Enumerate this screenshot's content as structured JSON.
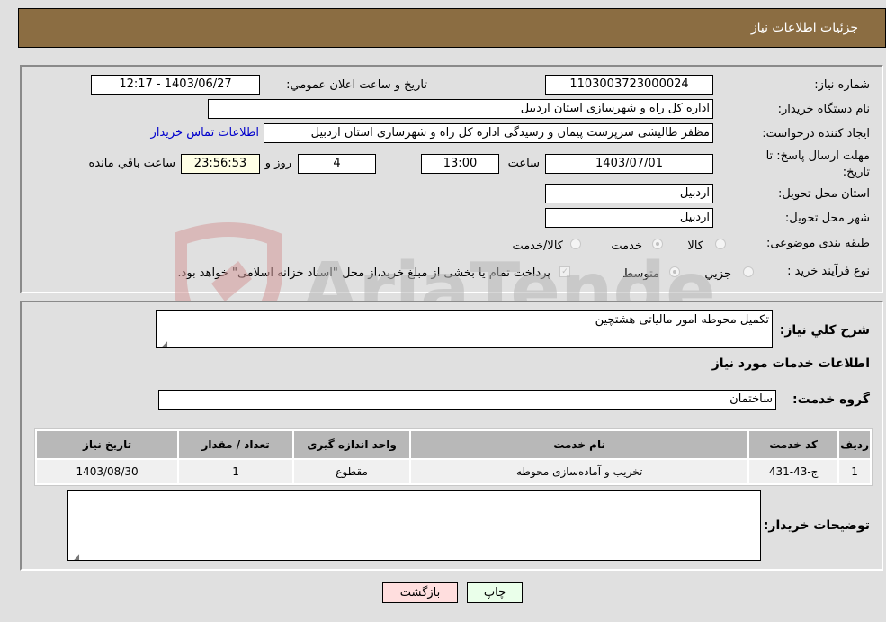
{
  "header": {
    "title": "جزئیات اطلاعات نیاز"
  },
  "need_info": {
    "need_number_label": "شماره نیاز:",
    "need_number": "1103003723000024",
    "announce_label": "تاریخ و ساعت اعلان عمومي:",
    "announce_value": "1403/06/27 - 12:17",
    "buyer_org_label": "نام دستگاه خریدار:",
    "buyer_org": "اداره کل راه و شهرسازی استان اردبیل",
    "creator_label": "ایجاد کننده درخواست:",
    "creator": "مظفر طالیشی سرپرست پیمان و رسیدگی اداره کل راه و شهرسازی استان اردبیل",
    "contact_link": "اطلاعات تماس خریدار",
    "deadline_label": "مهلت ارسال پاسخ: تا تاریخ:",
    "deadline_date": "1403/07/01",
    "time_label": "ساعت",
    "deadline_time": "13:00",
    "days_value": "4",
    "days_label": "روز و",
    "remaining_time": "23:56:53",
    "remaining_label": "ساعت باقي مانده",
    "province_label": "استان محل تحویل:",
    "province": "اردبیل",
    "city_label": "شهر محل تحویل:",
    "city": "اردبیل",
    "category_label": "طبقه بندی موضوعی:",
    "category_options": [
      "کالا",
      "خدمت",
      "کالا/خدمت"
    ],
    "category_selected": "خدمت",
    "process_label": "نوع فرآیند خرید :",
    "process_options": [
      "جزيي",
      "متوسط"
    ],
    "process_selected": "متوسط",
    "treasury_note": "پرداخت تمام یا بخشی از مبلغ خرید،از محل \"اسناد خزانه اسلامی\" خواهد بود."
  },
  "details": {
    "description_label": "شرح کلي نياز:",
    "description": "تکمیل محوطه امور مالیاتی هشتچین",
    "services_heading": "اطلاعات خدمات مورد نیاز",
    "service_group_label": "گروه خدمت:",
    "service_group": "ساختمان",
    "table": {
      "headers": [
        "ردیف",
        "کد خدمت",
        "نام خدمت",
        "واحد اندازه گیری",
        "تعداد / مقدار",
        "تاریخ نیاز"
      ],
      "rows": [
        [
          "1",
          "ج-43-431",
          "تخریب و آماده‌سازی محوطه",
          "مقطوع",
          "1",
          "1403/08/30"
        ]
      ]
    },
    "buyer_notes_label": "توضیحات خریدار:",
    "buyer_notes": ""
  },
  "buttons": {
    "print": "چاپ",
    "back": "بازگشت"
  },
  "watermark": {
    "text": "AriaTender.neT"
  },
  "colors": {
    "header_bg": "#8b6d42",
    "print_bg": "#eaffea",
    "back_bg": "#ffdede",
    "link": "#0000cc"
  }
}
